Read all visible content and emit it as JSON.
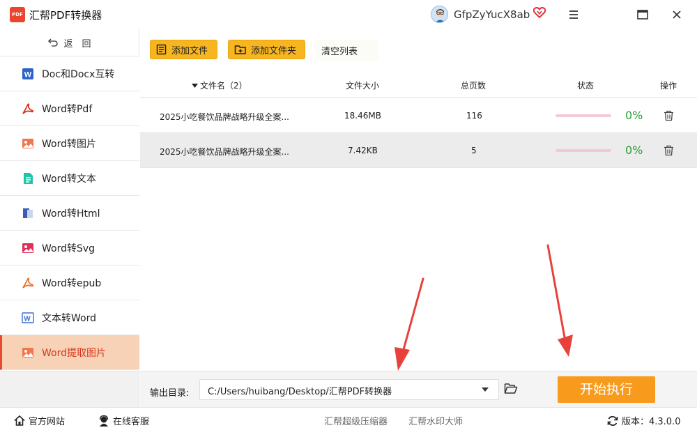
{
  "window": {
    "title": "汇帮PDF转换器",
    "logo_text": "PDF",
    "username": "GfpZyYucX8ab"
  },
  "sidebar": {
    "back_label": "返　回",
    "items": [
      {
        "label": "Doc和Docx互转",
        "icon": "word-doc-icon",
        "active": false
      },
      {
        "label": "Word转Pdf",
        "icon": "pdf-icon",
        "active": false
      },
      {
        "label": "Word转图片",
        "icon": "image-icon",
        "active": false
      },
      {
        "label": "Word转文本",
        "icon": "text-file-icon",
        "active": false
      },
      {
        "label": "Word转Html",
        "icon": "html-icon",
        "active": false
      },
      {
        "label": "Word转Svg",
        "icon": "svg-icon",
        "active": false
      },
      {
        "label": "Word转epub",
        "icon": "epub-icon",
        "active": false
      },
      {
        "label": "文本转Word",
        "icon": "word-icon",
        "active": false
      },
      {
        "label": "Word提取图片",
        "icon": "image-extract-icon",
        "active": true
      }
    ]
  },
  "toolbar": {
    "add_file": "添加文件",
    "add_folder": "添加文件夹",
    "clear_list": "清空列表"
  },
  "table": {
    "headers": {
      "filename": "文件名（2）",
      "size": "文件大小",
      "pages": "总页数",
      "status": "状态",
      "action": "操作"
    },
    "rows": [
      {
        "name": "2025小吃餐饮品牌战略升级全案...",
        "size": "18.46MB",
        "pages": "116",
        "progress": "0%",
        "selected": false
      },
      {
        "name": "2025小吃餐饮品牌战略升级全案...",
        "size": "7.42KB",
        "pages": "5",
        "progress": "0%",
        "selected": true
      }
    ]
  },
  "output": {
    "label": "输出目录:",
    "path": "C:/Users/huibang/Desktop/汇帮PDF转换器",
    "start_label": "开始执行"
  },
  "footer": {
    "website": "官方网站",
    "support": "在线客服",
    "link1": "汇帮超级压缩器",
    "link2": "汇帮水印大师",
    "version": "版本：4.3.0.0"
  },
  "colors": {
    "accent_orange": "#f89a1c",
    "button_yellow": "#f7b520",
    "active_bg": "#f7d2b6",
    "active_text": "#d9361c",
    "progress_green": "#26a034",
    "annotation_red": "#e8413a"
  }
}
